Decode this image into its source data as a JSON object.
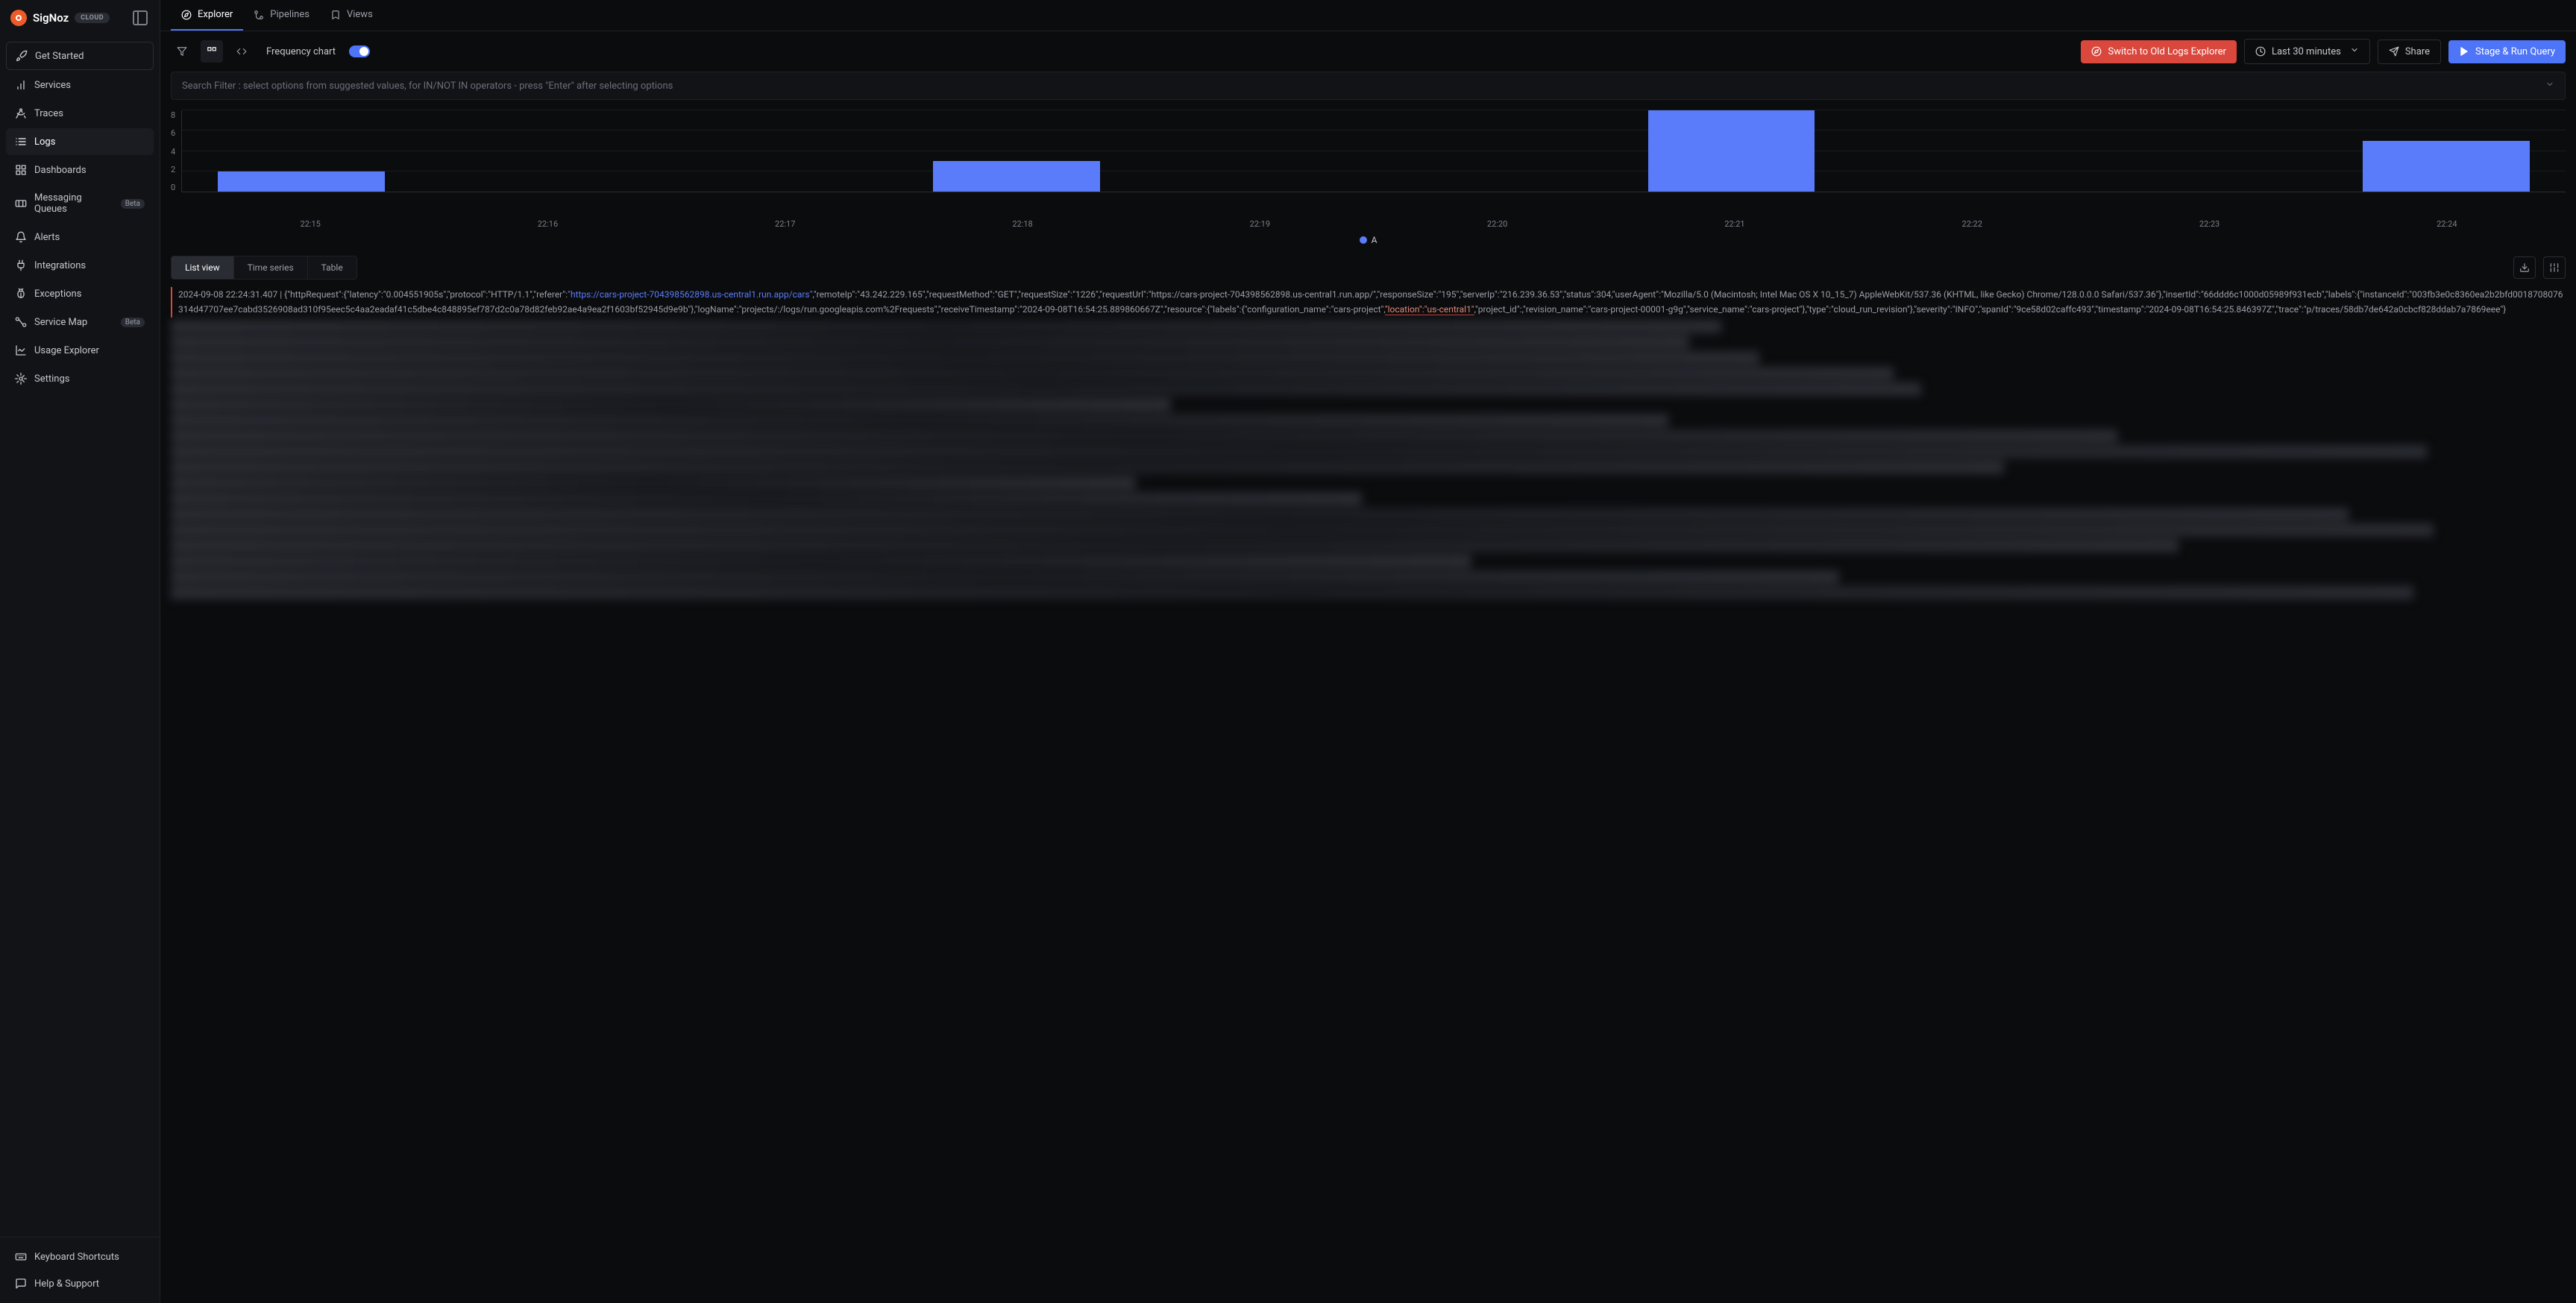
{
  "brand": "SigNoz",
  "cloud_badge": "CLOUD",
  "sidebar": {
    "items": [
      {
        "label": "Get Started",
        "icon": "rocket"
      },
      {
        "label": "Services",
        "icon": "bar-chart"
      },
      {
        "label": "Traces",
        "icon": "drafting"
      },
      {
        "label": "Logs",
        "icon": "logs"
      },
      {
        "label": "Dashboards",
        "icon": "grid"
      },
      {
        "label": "Messaging Queues",
        "icon": "queue",
        "beta": "Beta"
      },
      {
        "label": "Alerts",
        "icon": "bell"
      },
      {
        "label": "Integrations",
        "icon": "plug"
      },
      {
        "label": "Exceptions",
        "icon": "bug"
      },
      {
        "label": "Service Map",
        "icon": "map",
        "beta": "Beta"
      },
      {
        "label": "Usage Explorer",
        "icon": "chart-line"
      },
      {
        "label": "Settings",
        "icon": "gear"
      }
    ],
    "footer": [
      {
        "label": "Keyboard Shortcuts",
        "icon": "keyboard"
      },
      {
        "label": "Help & Support",
        "icon": "chat"
      }
    ]
  },
  "tabs": [
    {
      "label": "Explorer",
      "icon": "compass"
    },
    {
      "label": "Pipelines",
      "icon": "git-branch"
    },
    {
      "label": "Views",
      "icon": "bookmark"
    }
  ],
  "toolbar": {
    "frequency_label": "Frequency chart",
    "switch_old": "Switch to Old Logs Explorer",
    "time_range": "Last 30 minutes",
    "share": "Share",
    "run_query": "Stage & Run Query"
  },
  "search_placeholder": "Search Filter : select options from suggested values, for IN/NOT IN operators - press \"Enter\" after selecting options",
  "chart_data": {
    "type": "bar",
    "categories": [
      "22:15",
      "22:16",
      "22:17",
      "22:18",
      "22:19",
      "22:20",
      "22:21",
      "22:22",
      "22:23",
      "22:24"
    ],
    "values": [
      2,
      0,
      0,
      3,
      0,
      0,
      8,
      0,
      0,
      5
    ],
    "ylim": [
      0,
      8
    ],
    "yticks": [
      0,
      2,
      4,
      6,
      8
    ],
    "legend": "A"
  },
  "view_tabs": [
    "List view",
    "Time series",
    "Table"
  ],
  "log": {
    "timestamp": "2024-09-08 22:24:31.407",
    "prefix": " | {\"httpRequest\":{\"latency\":\"0.004551905s\",\"protocol\":\"HTTP/1.1\",\"referer\":",
    "url": "\"https://cars-project-704398562898.us-central1.run.app/cars\"",
    "mid1": ",\"remoteIp\":\"43.242.229.165\",\"requestMethod\":\"GET\",\"requestSize\":\"1226\",\"requestUrl\":\"https://cars-project-704398562898.us-central1.run.app/\",\"responseSize\":\"195\",\"serverIp\":\"216.239.36.53\",\"status\":304,\"userAgent\":\"Mozilla/5.0 (Macintosh; Intel Mac OS X 10_15_7) AppleWebKit/537.36 (KHTML, like Gecko) Chrome/128.0.0.0 Safari/537.36\"},\"insertId\":\"66ddd6c1000d05989f931ecb\",\"labels\":{\"instanceId\":\"003fb3e0c8360ea2b2bfd0018708076314d47707ee7cabd3526908ad310f95eec5c4aa2eadaf41c5dbe4c848895ef787d2c0a78d82feb92ae4a9ea2f1603bf52945d9e9b\"},\"logName\":\"projects/:/logs/run.googleapis.com%2Frequests\",\"receiveTimestamp\":\"2024-09-08T16:54:25.889860667Z\",\"resource\":{\"labels\":{\"configuration_name\":\"cars-project\",",
    "red": "\"location\":\"us-central1\"",
    "mid2": ",\"project_id\":,\"revision_name\":\"cars-project-00001-g9g\",\"service_name\":\"cars-project\"},\"type\":\"cloud_run_revision\"},\"severity\":\"INFO\",\"spanId\":\"9ce58d02caffc493\",\"timestamp\":\"2024-09-08T16:54:25.846397Z\",\"trace\":\"p/traces/58db7de642a0cbcf828ddab7a7869eee\"}"
  }
}
